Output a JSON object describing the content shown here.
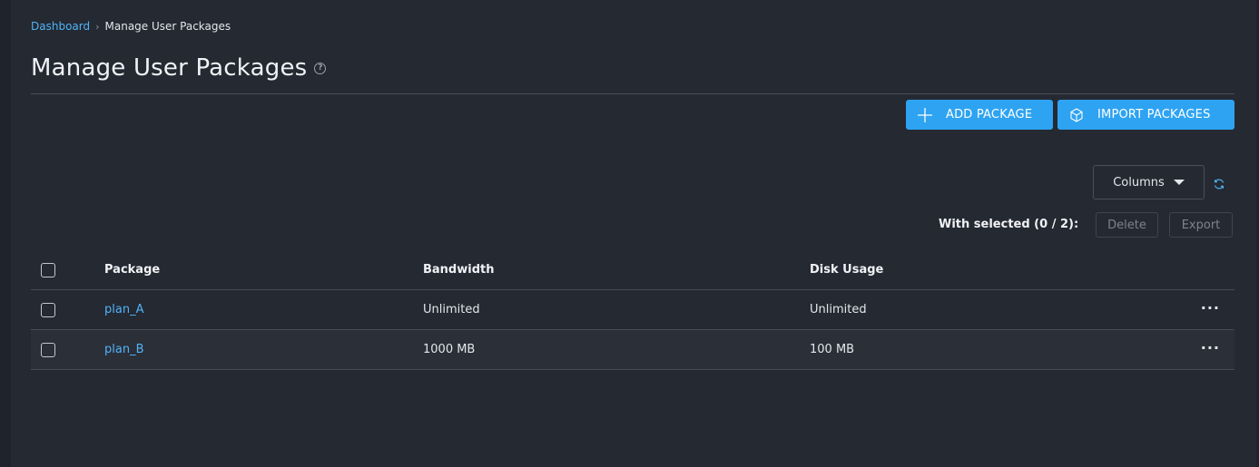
{
  "breadcrumb": {
    "root": "Dashboard",
    "separator": "›",
    "current": "Manage User Packages"
  },
  "page": {
    "title": "Manage User Packages",
    "help_icon": "?"
  },
  "actions": {
    "add_label": "ADD PACKAGE",
    "import_label": "IMPORT PACKAGES"
  },
  "toolbar": {
    "columns_label": "Columns",
    "with_selected": "With selected (0 / 2):",
    "delete_label": "Delete",
    "export_label": "Export"
  },
  "table": {
    "headers": {
      "package": "Package",
      "bandwidth": "Bandwidth",
      "disk": "Disk Usage"
    },
    "rows": [
      {
        "package": "plan_A",
        "bandwidth": "Unlimited",
        "disk": "Unlimited",
        "actions": "···"
      },
      {
        "package": "plan_B",
        "bandwidth": "1000 MB",
        "disk": "100 MB",
        "actions": "···"
      }
    ]
  },
  "icons": {
    "add": "plus-icon",
    "import": "box-icon",
    "refresh": "refresh-icon",
    "caret": "caret-down-icon",
    "help": "help-icon"
  },
  "colors": {
    "accent": "#2ea3f2",
    "link": "#4fb3f6",
    "background": "#252932"
  }
}
